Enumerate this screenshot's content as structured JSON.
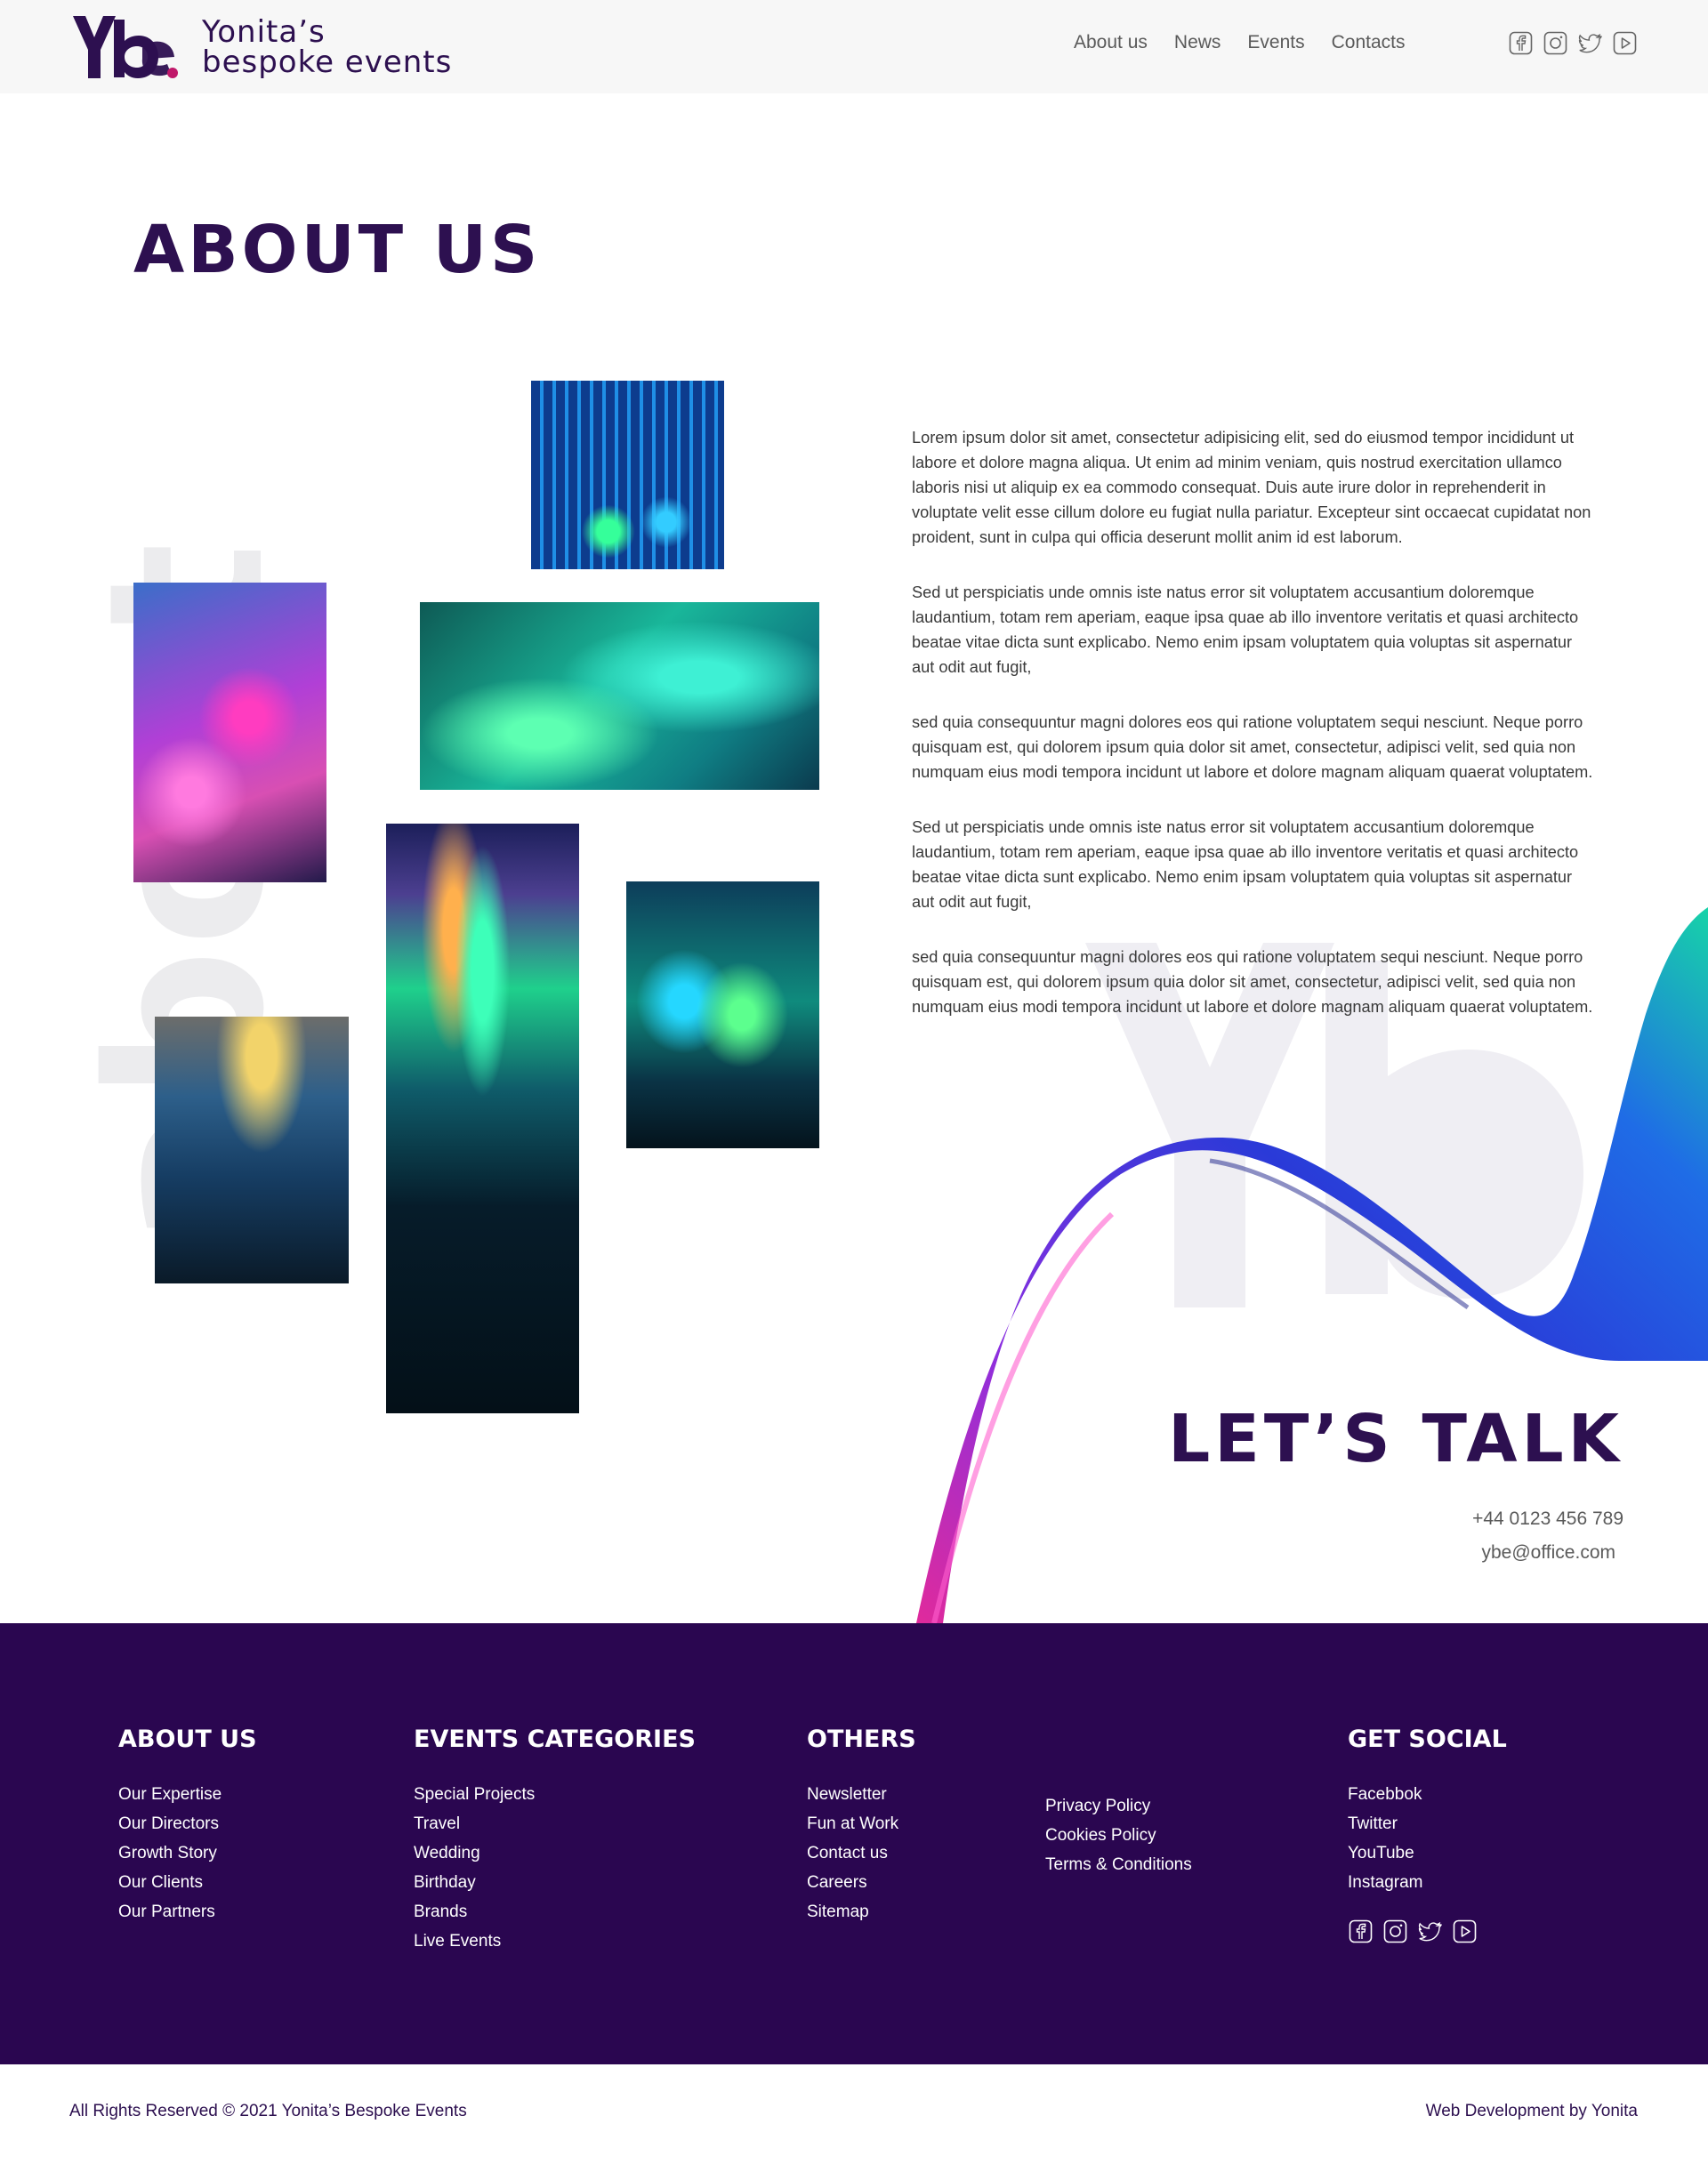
{
  "header": {
    "brand_line1": "Yonita’s",
    "brand_line2": "bespoke events",
    "nav": [
      "About us",
      "News",
      "Events",
      "Contacts"
    ],
    "social_icons": [
      "facebook-icon",
      "instagram-icon",
      "twitter-icon",
      "youtube-icon"
    ]
  },
  "main": {
    "title": "ABOUT US",
    "paragraphs": [
      "Lorem ipsum dolor sit amet, consectetur adipisicing elit, sed do eiusmod tempor incididunt ut labore et dolore magna aliqua. Ut enim ad minim veniam, quis nostrud exercitation ullamco laboris nisi ut aliquip ex ea commodo consequat. Duis aute irure dolor in reprehenderit in voluptate velit esse cillum dolore eu fugiat nulla pariatur. Excepteur sint occaecat cupidatat non proident, sunt in culpa qui officia deserunt mollit anim id est laborum.",
      "Sed ut perspiciatis unde omnis iste natus error sit voluptatem accusantium doloremque laudantium, totam rem aperiam, eaque ipsa quae ab illo inventore veritatis et quasi architecto beatae vitae dicta sunt explicabo. Nemo enim ipsam voluptatem quia voluptas sit aspernatur aut odit aut fugit,",
      "sed quia consequuntur magni dolores eos qui ratione voluptatem sequi nesciunt. Neque porro quisquam est, qui dolorem ipsum quia dolor sit amet, consectetur, adipisci velit, sed quia non numquam eius modi tempora incidunt ut labore et dolore magnam aliquam quaerat voluptatem.",
      "Sed ut perspiciatis unde omnis iste natus error sit voluptatem accusantium doloremque laudantium, totam rem aperiam, eaque ipsa quae ab illo inventore veritatis et quasi architecto beatae vitae dicta sunt explicabo. Nemo enim ipsam voluptatem quia voluptas sit aspernatur aut odit aut fugit,",
      "sed quia consequuntur magni dolores eos qui ratione voluptatem sequi nesciunt. Neque porro quisquam est, qui dolorem ipsum quia dolor sit amet, consectetur, adipisci velit, sed quia non numquam eius modi tempora incidunt ut labore et dolore magnam aliquam quaerat voluptatem."
    ],
    "background_word": "about"
  },
  "contact": {
    "title": "LET’S TALK",
    "phone": "+44 0123 456 789",
    "email": "ybe@office.com"
  },
  "footer": {
    "about": {
      "heading": "ABOUT US",
      "links": [
        "Our Expertise",
        "Our Directors",
        "Growth Story",
        "Our Clients",
        "Our Partners"
      ]
    },
    "events": {
      "heading": "EVENTS CATEGORIES",
      "links": [
        "Special Projects",
        "Travel",
        "Wedding",
        "Birthday",
        "Brands",
        "Live Events"
      ]
    },
    "others": {
      "heading": "OTHERS",
      "links": [
        "Newsletter",
        "Fun at Work",
        "Contact us",
        "Careers",
        "Sitemap"
      ],
      "links2": [
        "Privacy Policy",
        "Cookies Policy",
        "Terms & Conditions"
      ]
    },
    "social": {
      "heading": "GET SOCIAL",
      "links": [
        "Facebbok",
        "Twitter",
        "YouTube",
        "Instagram"
      ]
    },
    "copyright": "All Rights Reserved © 2021 Yonita’s Bespoke Events",
    "credit": "Web Development by Yonita"
  },
  "colors": {
    "brand": "#2d1050",
    "accent": "#c0186a",
    "footer_bg": "#2a0650"
  }
}
